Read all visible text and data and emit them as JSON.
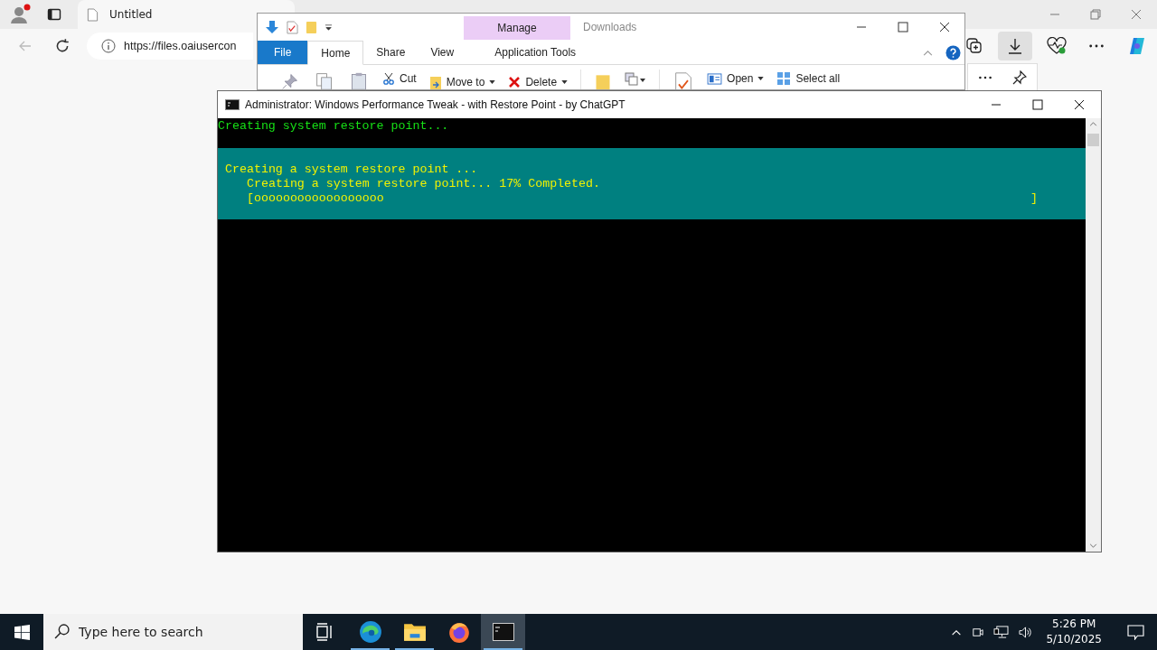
{
  "browser": {
    "tab_title": "Untitled",
    "address": "https://files.oaiusercon"
  },
  "explorer": {
    "title": "Downloads",
    "context_tab": "Manage",
    "tabs": [
      {
        "label": "File",
        "kind": "file",
        "selected": false
      },
      {
        "label": "Home",
        "kind": "tab",
        "selected": true
      },
      {
        "label": "Share",
        "kind": "tab",
        "selected": false
      },
      {
        "label": "View",
        "kind": "tab",
        "selected": false
      },
      {
        "label": "Application Tools",
        "kind": "context",
        "selected": false
      }
    ],
    "ribbon": [
      {
        "label": "Cut",
        "kind": "cut"
      },
      {
        "label": "Move to",
        "kind": "move"
      },
      {
        "label": "Delete",
        "kind": "delete"
      },
      {
        "label": "Open",
        "kind": "open"
      },
      {
        "label": "Select all",
        "kind": "select"
      }
    ]
  },
  "console": {
    "title": "Administrator:  Windows Performance Tweak - with Restore Point - by ChatGPT",
    "lines": [
      {
        "text": "Creating system restore point..."
      }
    ],
    "progress": {
      "heading": "Creating a system restore point ...",
      "status": "Creating a system restore point... 17% Completed.",
      "bar": "[oooooooooooooooooo",
      "bar_end": "]"
    }
  },
  "taskbar": {
    "search_placeholder": "Type here to search",
    "apps": [
      {
        "kind": "edge",
        "running": true,
        "selected": false
      },
      {
        "kind": "explorer",
        "running": true,
        "selected": false
      },
      {
        "kind": "firefox",
        "running": false,
        "selected": false
      },
      {
        "kind": "terminal",
        "running": true,
        "selected": true
      }
    ],
    "time": "5:26 PM",
    "date": "5/10/2025"
  }
}
